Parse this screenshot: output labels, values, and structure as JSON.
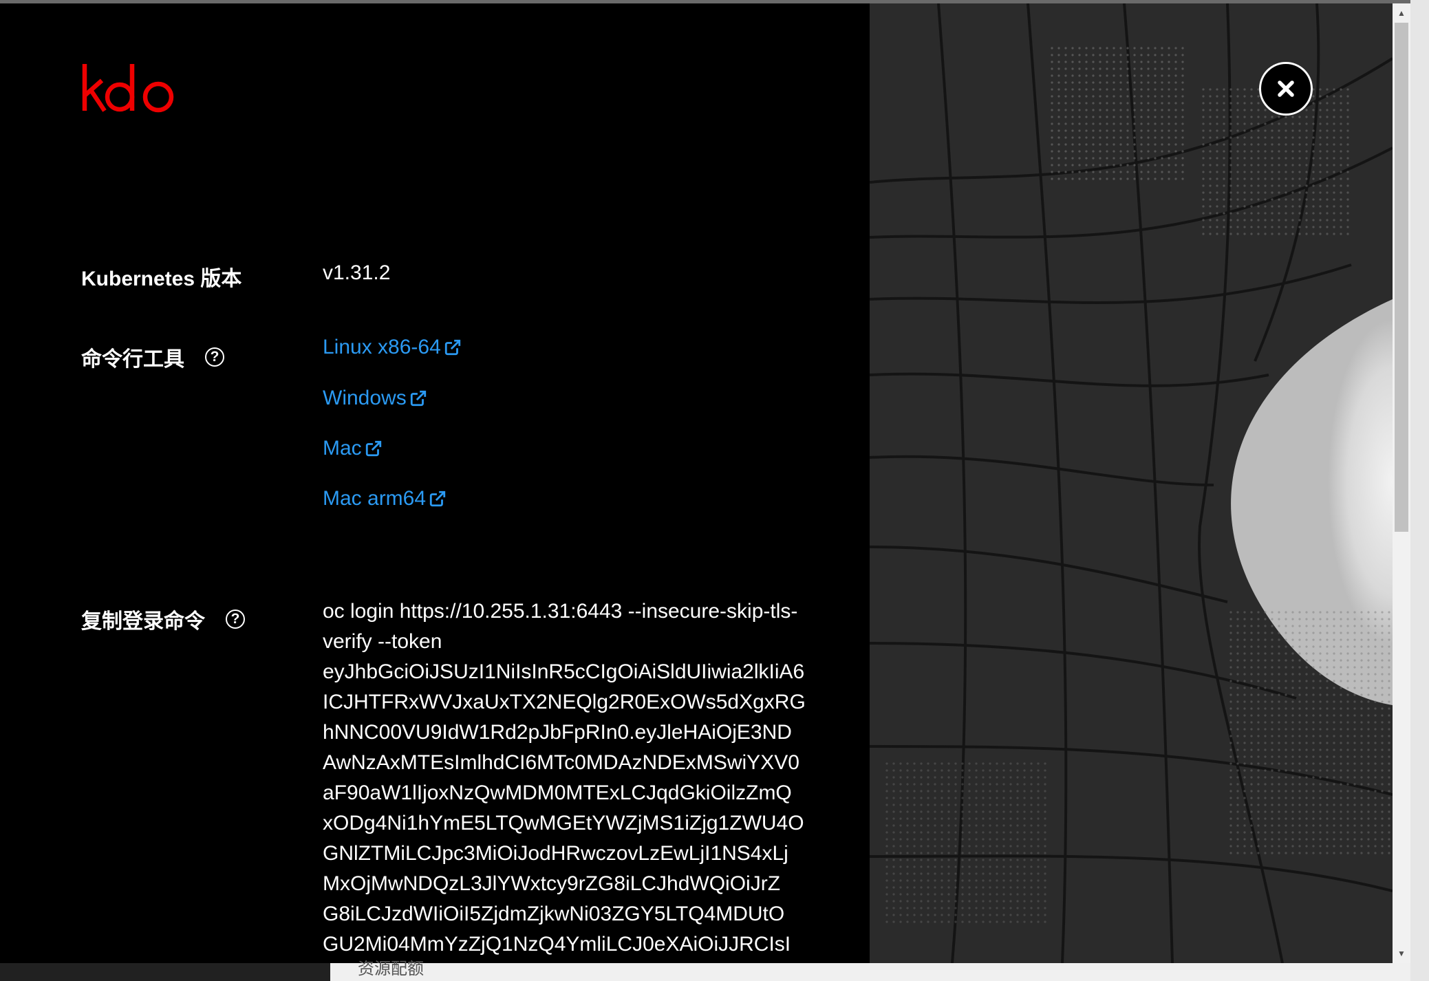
{
  "logo": {
    "text": "kdo",
    "color": "#ee0000"
  },
  "close_button": {
    "icon": "close-icon"
  },
  "kubernetes": {
    "label": "Kubernetes 版本",
    "value": "v1.31.2"
  },
  "cli": {
    "label": "命令行工具",
    "help_icon": "question-circle-icon",
    "links": [
      {
        "label": "Linux x86-64",
        "icon": "external-link-icon"
      },
      {
        "label": "Windows",
        "icon": "external-link-icon"
      },
      {
        "label": "Mac",
        "icon": "external-link-icon"
      },
      {
        "label": "Mac arm64",
        "icon": "external-link-icon"
      }
    ]
  },
  "login": {
    "label": "复制登录命令",
    "help_icon": "question-circle-icon",
    "command_lines": [
      "oc login https://10.255.1.31:6443 --insecure-skip-tls-",
      "verify --token",
      "eyJhbGciOiJSUzI1NiIsInR5cCIgOiAiSldUIiwia2lkIiA6",
      "ICJHTFRxWVJxaUxTX2NEQlg2R0ExOWs5dXgxRG",
      "hNNC00VU9IdW1Rd2pJbFpRIn0.eyJleHAiOjE3ND",
      "AwNzAxMTEsImlhdCI6MTc0MDAzNDExMSwiYXV0",
      "aF90aW1lIjoxNzQwMDM0MTExLCJqdGkiOilzZmQ",
      "xODg4Ni1hYmE5LTQwMGEtYWZjMS1iZjg1ZWU4O",
      "GNlZTMiLCJpc3MiOiJodHRwczovLzEwLjI1NS4xLj",
      "MxOjMwNDQzL3JlYWxtcy9rZG8iLCJhdWQiOiJrZ",
      "G8iLCJzdWIiOiI5ZjdmZjkwNi03ZGY5LTQ4MDUtO",
      "GU2Mi04MmYzZjQ1NzQ4YmliLCJ0eXAiOiJJRCIsI"
    ]
  },
  "background_text": "资源配额",
  "colors": {
    "link": "#2b9af3",
    "background": "#000000"
  }
}
